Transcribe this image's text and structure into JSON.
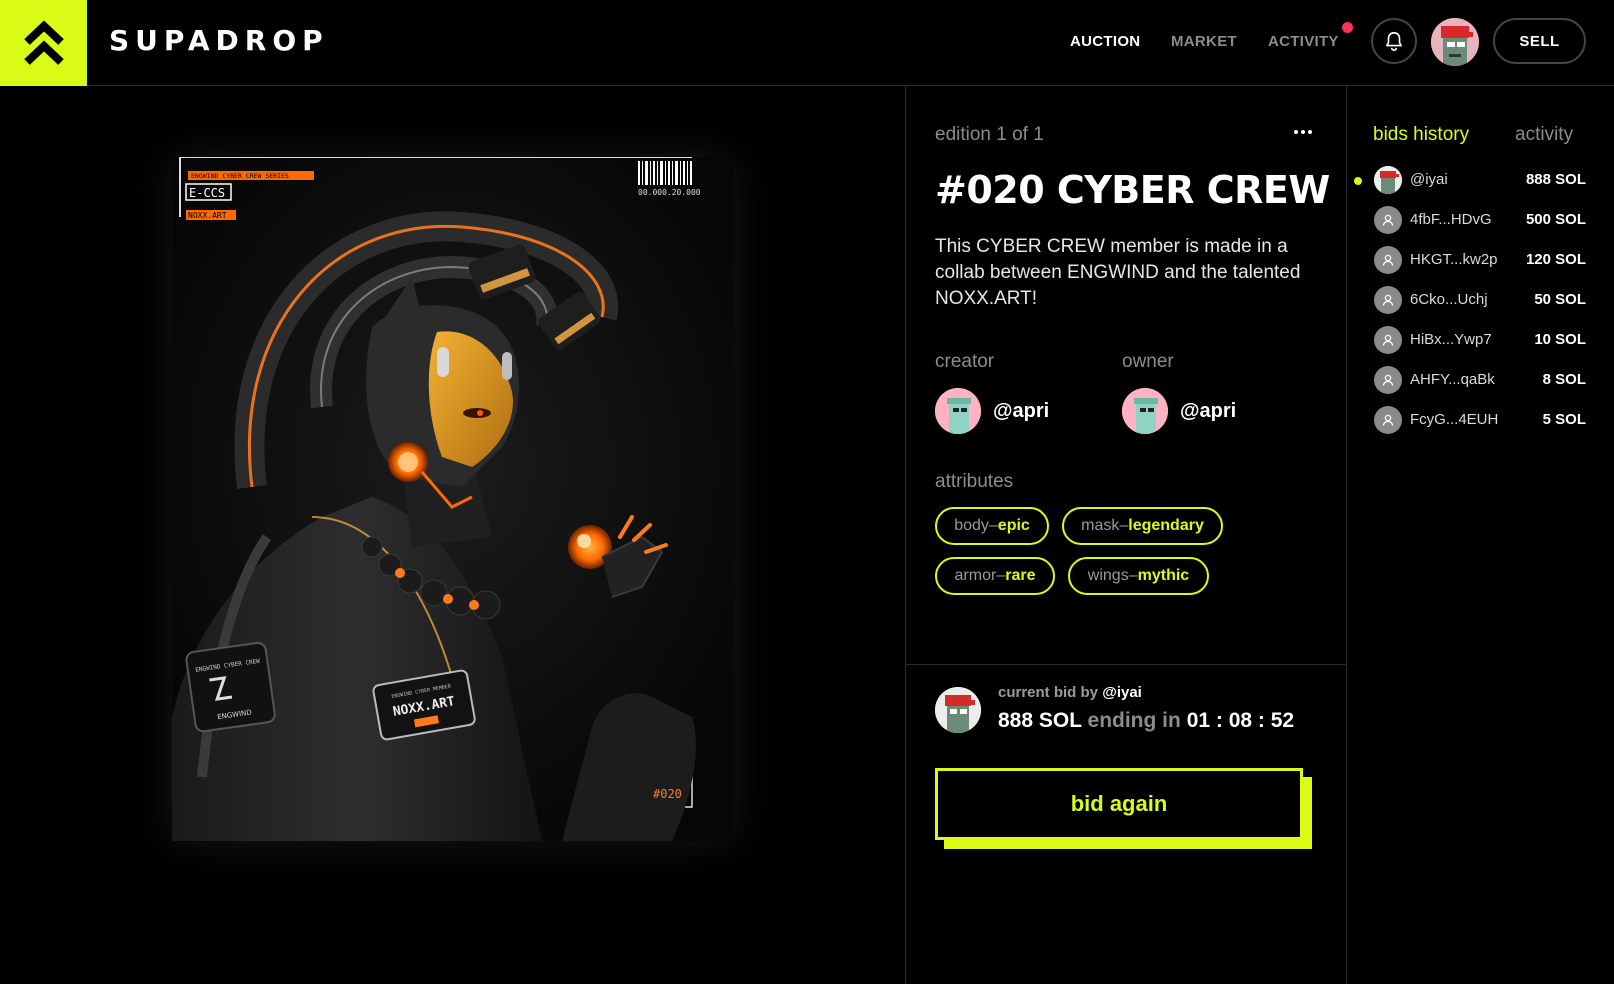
{
  "brand": {
    "name": "SUPADROP",
    "logo_icon": "double-chevron-up-icon",
    "accent_color": "#d9fb16"
  },
  "nav": {
    "items": [
      {
        "label": "AUCTION",
        "active": true
      },
      {
        "label": "MARKET",
        "active": false
      },
      {
        "label": "ACTIVITY",
        "active": false,
        "has_notification_dot": true
      }
    ],
    "bell_icon": "bell-icon",
    "sell_label": "SELL"
  },
  "artwork": {
    "series_label": "ENGWIND CYBER CREW SERIES",
    "code_label": "E-CCS",
    "artist_tag": "NOXX.ART",
    "barcode_text": "00.000.20.000",
    "number_tag": "#020",
    "patch_left_title": "ENGWIND CYBER CREW",
    "patch_left_name": "ENGWIND",
    "patch_right_title": "ENGWIND CYBER MEMBER",
    "patch_right_name": "NOXX.ART"
  },
  "detail": {
    "edition": "edition 1 of 1",
    "title": "#020 CYBER CREW",
    "description": "This CYBER CREW member is made in a collab between ENGWIND and the talented NOXX.ART!",
    "creator_label": "creator",
    "creator_name": "@apri",
    "owner_label": "owner",
    "owner_name": "@apri",
    "attributes_label": "attributes",
    "attributes": [
      {
        "key": "body",
        "sep": " – ",
        "value": "epic"
      },
      {
        "key": "mask",
        "sep": " – ",
        "value": "legendary"
      },
      {
        "key": "armor",
        "sep": " – ",
        "value": "rare"
      },
      {
        "key": "wings",
        "sep": " – ",
        "value": "mythic"
      }
    ]
  },
  "current_bid": {
    "prefix": "current bid by ",
    "user": "@iyai",
    "amount": "888 SOL",
    "ending_label": "ending in",
    "countdown": "01 : 08 : 52",
    "button_label": "bid again"
  },
  "bids_panel": {
    "tab_bids": "bids history",
    "tab_activity": "activity",
    "rows": [
      {
        "user": "@iyai",
        "amount": "888 SOL",
        "latest": true
      },
      {
        "user": "4fbF...HDvG",
        "amount": "500 SOL",
        "latest": false
      },
      {
        "user": "HKGT...kw2p",
        "amount": "120 SOL",
        "latest": false
      },
      {
        "user": "6Cko...Uchj",
        "amount": "50 SOL",
        "latest": false
      },
      {
        "user": "HiBx...Ywp7",
        "amount": "10 SOL",
        "latest": false
      },
      {
        "user": "AHFY...qaBk",
        "amount": "8 SOL",
        "latest": false
      },
      {
        "user": "FcyG...4EUH",
        "amount": "5 SOL",
        "latest": false
      }
    ]
  }
}
